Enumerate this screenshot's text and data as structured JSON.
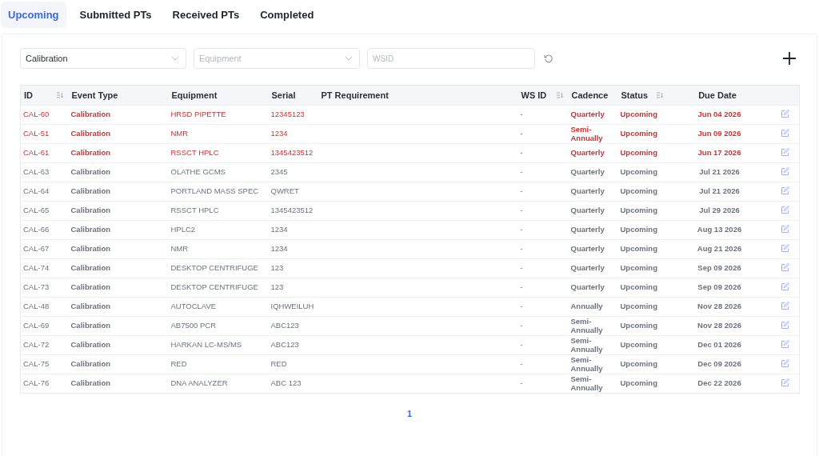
{
  "tabs": [
    {
      "label": "Upcoming",
      "selected": true
    },
    {
      "label": "Submitted PTs",
      "selected": false
    },
    {
      "label": "Received PTs",
      "selected": false
    },
    {
      "label": "Completed",
      "selected": false
    }
  ],
  "filters": {
    "event_type": {
      "value": "Calibration"
    },
    "equipment": {
      "placeholder": "Equipment"
    },
    "wsid": {
      "placeholder": "WSID"
    }
  },
  "table": {
    "columns": [
      {
        "label": "ID",
        "sortable": true
      },
      {
        "label": "Event Type",
        "sortable": false
      },
      {
        "label": "Equipment",
        "sortable": false
      },
      {
        "label": "Serial",
        "sortable": false
      },
      {
        "label": "PT Requirement",
        "sortable": false
      },
      {
        "label": "WS ID",
        "sortable": true
      },
      {
        "label": "Cadence",
        "sortable": false
      },
      {
        "label": "Status",
        "sortable": true
      },
      {
        "label": "Due Date",
        "sortable": false
      }
    ],
    "rows": [
      {
        "id": "CAL-60",
        "event_type": "Calibration",
        "equipment": "HRSD PIPETTE",
        "serial": "12345123",
        "ws_id": "-",
        "cadence": "Quarterly",
        "status": "Upcoming",
        "due_date": "Jun 04 2026",
        "urgent": true
      },
      {
        "id": "CAL-51",
        "event_type": "Calibration",
        "equipment": "NMR",
        "serial": "1234",
        "ws_id": "-",
        "cadence": "Semi-Annually",
        "status": "Upcoming",
        "due_date": "Jun 09 2026",
        "urgent": true
      },
      {
        "id": "CAL-61",
        "event_type": "Calibration",
        "equipment": "RSSCT HPLC",
        "serial": "1345423512",
        "ws_id": "-",
        "cadence": "Quarterly",
        "status": "Upcoming",
        "due_date": "Jun 17 2026",
        "urgent": true
      },
      {
        "id": "CAL-63",
        "event_type": "Calibration",
        "equipment": "OLATHE GCMS",
        "serial": "2345",
        "ws_id": "-",
        "cadence": "Quarterly",
        "status": "Upcoming",
        "due_date": "Jul 21 2026",
        "urgent": false
      },
      {
        "id": "CAL-64",
        "event_type": "Calibration",
        "equipment": "PORTLAND MASS SPEC",
        "serial": "QWRET",
        "ws_id": "-",
        "cadence": "Quarterly",
        "status": "Upcoming",
        "due_date": "Jul 21 2026",
        "urgent": false
      },
      {
        "id": "CAL-65",
        "event_type": "Calibration",
        "equipment": "RSSCT HPLC",
        "serial": "1345423512",
        "ws_id": "-",
        "cadence": "Quarterly",
        "status": "Upcoming",
        "due_date": "Jul 29 2026",
        "urgent": false
      },
      {
        "id": "CAL-66",
        "event_type": "Calibration",
        "equipment": "HPLC2",
        "serial": "1234",
        "ws_id": "-",
        "cadence": "Quarterly",
        "status": "Upcoming",
        "due_date": "Aug 13 2026",
        "urgent": false
      },
      {
        "id": "CAL-67",
        "event_type": "Calibration",
        "equipment": "NMR",
        "serial": "1234",
        "ws_id": "-",
        "cadence": "Quarterly",
        "status": "Upcoming",
        "due_date": "Aug 21 2026",
        "urgent": false
      },
      {
        "id": "CAL-74",
        "event_type": "Calibration",
        "equipment": "DESKTOP CENTRIFUGE",
        "serial": "123",
        "ws_id": "-",
        "cadence": "Quarterly",
        "status": "Upcoming",
        "due_date": "Sep 09 2026",
        "urgent": false
      },
      {
        "id": "CAL-73",
        "event_type": "Calibration",
        "equipment": "DESKTOP CENTRIFUGE",
        "serial": "123",
        "ws_id": "-",
        "cadence": "Quarterly",
        "status": "Upcoming",
        "due_date": "Sep 09 2026",
        "urgent": false
      },
      {
        "id": "CAL-48",
        "event_type": "Calibration",
        "equipment": "AUTOCLAVE",
        "serial": "IQHWEILUH",
        "ws_id": "-",
        "cadence": "Annually",
        "status": "Upcoming",
        "due_date": "Nov 28 2026",
        "urgent": false
      },
      {
        "id": "CAL-69",
        "event_type": "Calibration",
        "equipment": "AB7500 PCR",
        "serial": "ABC123",
        "ws_id": "-",
        "cadence": "Semi-Annually",
        "status": "Upcoming",
        "due_date": "Nov 28 2026",
        "urgent": false
      },
      {
        "id": "CAL-72",
        "event_type": "Calibration",
        "equipment": "HARKAN LC-MS/MS",
        "serial": "ABC123",
        "ws_id": "-",
        "cadence": "Semi-Annually",
        "status": "Upcoming",
        "due_date": "Dec 01 2026",
        "urgent": false
      },
      {
        "id": "CAL-75",
        "event_type": "Calibration",
        "equipment": "RED",
        "serial": "RED",
        "ws_id": "-",
        "cadence": "Semi-Annually",
        "status": "Upcoming",
        "due_date": "Dec 09 2026",
        "urgent": false
      },
      {
        "id": "CAL-76",
        "event_type": "Calibration",
        "equipment": "DNA ANALYZER",
        "serial": "ABC 123",
        "ws_id": "-",
        "cadence": "Semi-Annually",
        "status": "Upcoming",
        "due_date": "Dec 22 2026",
        "urgent": false
      }
    ]
  },
  "pagination": {
    "pages": [
      {
        "label": "1",
        "selected": true
      }
    ]
  }
}
